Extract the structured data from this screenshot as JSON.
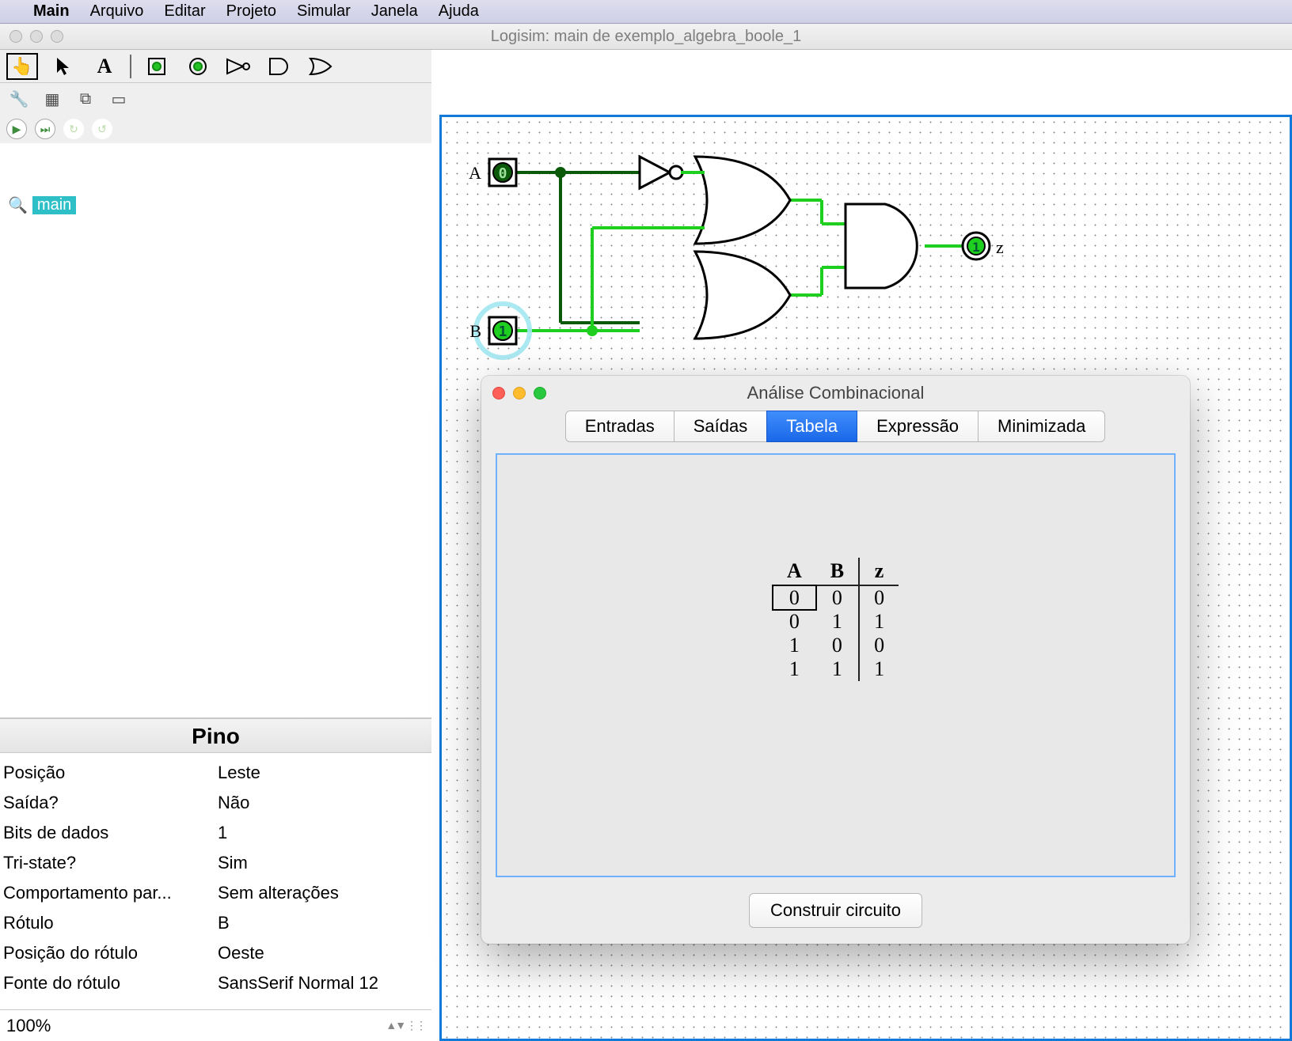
{
  "menubar": {
    "apple": "",
    "app": "Main",
    "items": [
      "Arquivo",
      "Editar",
      "Projeto",
      "Simular",
      "Janela",
      "Ajuda"
    ]
  },
  "window_title": "Logisim: main de exemplo_algebra_boole_1",
  "explorer": {
    "circuit": "main"
  },
  "properties": {
    "header": "Pino",
    "rows": [
      {
        "k": "Posição",
        "v": "Leste"
      },
      {
        "k": "Saída?",
        "v": "Não"
      },
      {
        "k": "Bits de dados",
        "v": "1"
      },
      {
        "k": "Tri-state?",
        "v": "Sim"
      },
      {
        "k": "Comportamento par...",
        "v": "Sem alterações"
      },
      {
        "k": "Rótulo",
        "v": "B"
      },
      {
        "k": "Posição do rótulo",
        "v": "Oeste"
      },
      {
        "k": "Fonte do rótulo",
        "v": "SansSerif Normal 12"
      }
    ]
  },
  "zoom": "100%",
  "circuit": {
    "pin_A": {
      "label": "A",
      "value": "0"
    },
    "pin_B": {
      "label": "B",
      "value": "1"
    },
    "out_z": {
      "label": "z",
      "value": "1"
    }
  },
  "dialog": {
    "title": "Análise Combinacional",
    "tabs": [
      "Entradas",
      "Saídas",
      "Tabela",
      "Expressão",
      "Minimizada"
    ],
    "active_tab": 2,
    "truth": {
      "headers": [
        "A",
        "B",
        "z"
      ],
      "rows": [
        [
          "0",
          "0",
          "0"
        ],
        [
          "0",
          "1",
          "1"
        ],
        [
          "1",
          "0",
          "0"
        ],
        [
          "1",
          "1",
          "1"
        ]
      ],
      "selected_cell": [
        0,
        0
      ]
    },
    "build_label": "Construir circuito"
  }
}
